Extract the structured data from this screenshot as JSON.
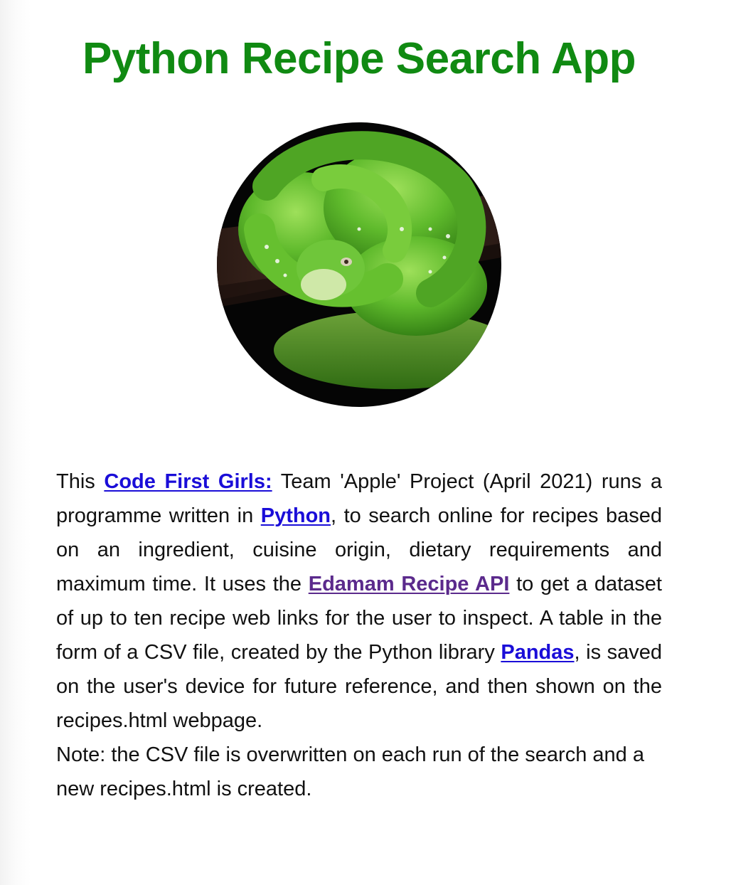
{
  "page": {
    "title": "Python Recipe Search App"
  },
  "hero": {
    "subject": "green-tree-python-photo"
  },
  "description": {
    "s1": "This ",
    "link_cfg": "Code First Girls:",
    "s2": " Team 'Apple' Project (April 2021) runs a programme written in ",
    "link_python": "Python",
    "s3": ", to search online for recipes based on an ingredient, cuisine origin, dietary requirements and maximum time. It uses the ",
    "link_edamam": "Edamam Recipe API",
    "s4": " to get a dataset of up to ten recipe web links for the user to inspect. A table in the form of a CSV file, created by the Python library ",
    "link_pandas": "Pandas",
    "s5": ", is saved on the user's device for future reference, and then shown on the recipes.html webpage.",
    "note": "Note: the CSV file is overwritten on each run of the search and a new recipes.html is created."
  },
  "colors": {
    "title": "#108a12",
    "link": "#1a0dd8",
    "link_visited": "#5b2a8c",
    "text": "#111111"
  }
}
